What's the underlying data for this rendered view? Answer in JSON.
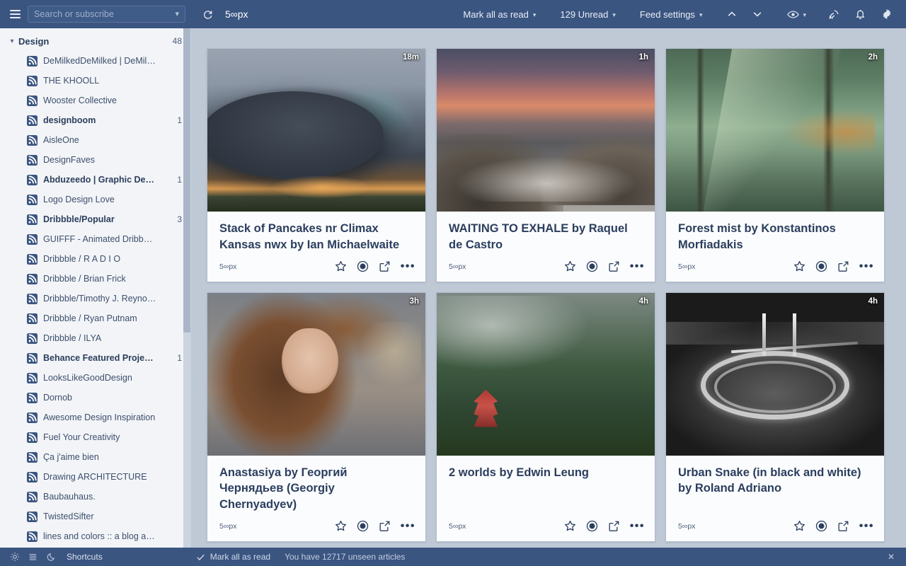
{
  "topbar": {
    "search_placeholder": "Search or subscribe",
    "feed_title": "5∞px",
    "mark_all_as_read": "Mark all as read",
    "unread_count_label": "129 Unread",
    "feed_settings": "Feed settings",
    "icons": {
      "menu": "hamburger-icon",
      "refresh": "refresh-icon",
      "prev": "chevron-up-icon",
      "next": "chevron-down-icon",
      "eye": "eye-icon",
      "rss": "rss-antenna-icon",
      "bell": "bell-icon",
      "gear": "gear-icon"
    }
  },
  "sidebar": {
    "group": {
      "name": "Design",
      "count": "48"
    },
    "feeds": [
      {
        "name": "DeMilkedDeMilked | DeMil…",
        "count": "",
        "unread": false
      },
      {
        "name": "THE KHOOLL",
        "count": "",
        "unread": false
      },
      {
        "name": "Wooster Collective",
        "count": "",
        "unread": false
      },
      {
        "name": "designboom",
        "count": "1",
        "unread": true
      },
      {
        "name": "AisleOne",
        "count": "",
        "unread": false
      },
      {
        "name": "DesignFaves",
        "count": "",
        "unread": false
      },
      {
        "name": "Abduzeedo | Graphic De…",
        "count": "1",
        "unread": true
      },
      {
        "name": "Logo Design Love",
        "count": "",
        "unread": false
      },
      {
        "name": "Dribbble/Popular",
        "count": "3",
        "unread": true
      },
      {
        "name": "GUIFFF - Animated Dribb…",
        "count": "",
        "unread": false
      },
      {
        "name": "Dribbble / R A D I O",
        "count": "",
        "unread": false
      },
      {
        "name": "Dribbble / Brian Frick",
        "count": "",
        "unread": false
      },
      {
        "name": "Dribbble/Timothy J. Reyno…",
        "count": "",
        "unread": false
      },
      {
        "name": "Dribbble / Ryan Putnam",
        "count": "",
        "unread": false
      },
      {
        "name": "Dribbble / ILYA",
        "count": "",
        "unread": false
      },
      {
        "name": "Behance Featured Proje…",
        "count": "1",
        "unread": true
      },
      {
        "name": "LooksLikeGoodDesign",
        "count": "",
        "unread": false
      },
      {
        "name": "Dornob",
        "count": "",
        "unread": false
      },
      {
        "name": "Awesome Design Inspiration",
        "count": "",
        "unread": false
      },
      {
        "name": "Fuel Your Creativity",
        "count": "",
        "unread": false
      },
      {
        "name": "Ça j'aime bien",
        "count": "",
        "unread": false
      },
      {
        "name": "Drawing ARCHITECTURE",
        "count": "",
        "unread": false
      },
      {
        "name": "Baubauhaus.",
        "count": "",
        "unread": false
      },
      {
        "name": "TwistedSifter",
        "count": "",
        "unread": false
      },
      {
        "name": "lines and colors :: a blog a…",
        "count": "",
        "unread": false
      }
    ]
  },
  "articles": [
    {
      "title": "Stack of Pancakes nr Climax Kansas nwx by Ian Michaelwaite",
      "source": "5∞px",
      "age": "18m",
      "art": "p-storm"
    },
    {
      "title": "WAITING TO EXHALE by Raquel de Castro",
      "source": "5∞px",
      "age": "1h",
      "art": "p-sea"
    },
    {
      "title": "Forest mist by Konstantinos Morfiadakis",
      "source": "5∞px",
      "age": "2h",
      "art": "p-forest"
    },
    {
      "title": "Anastasiya by Георгий Чернядьев (Georgiy Chernyadyev)",
      "source": "5∞px",
      "age": "3h",
      "art": "p-portrait"
    },
    {
      "title": "2 worlds by Edwin Leung",
      "source": "5∞px",
      "age": "4h",
      "art": "p-pagoda"
    },
    {
      "title": "Urban Snake (in black and white) by Roland Adriano",
      "source": "5∞px",
      "age": "4h",
      "art": "p-bridge"
    }
  ],
  "card_actions": {
    "star": "star-icon",
    "read": "read-toggle-icon",
    "share": "external-link-icon",
    "more": "•••"
  },
  "statusbar": {
    "shortcuts": "Shortcuts",
    "mark_all_as_read": "Mark all as read",
    "unseen_text": "You have 12717 unseen articles",
    "close": "✕"
  },
  "colors": {
    "chrome": "#3b5581",
    "sidebar_bg": "#f2f4f7",
    "main_bg": "#bfc9d6",
    "card_bg": "#fbfcfd",
    "text_dark": "#2b3e5e"
  }
}
